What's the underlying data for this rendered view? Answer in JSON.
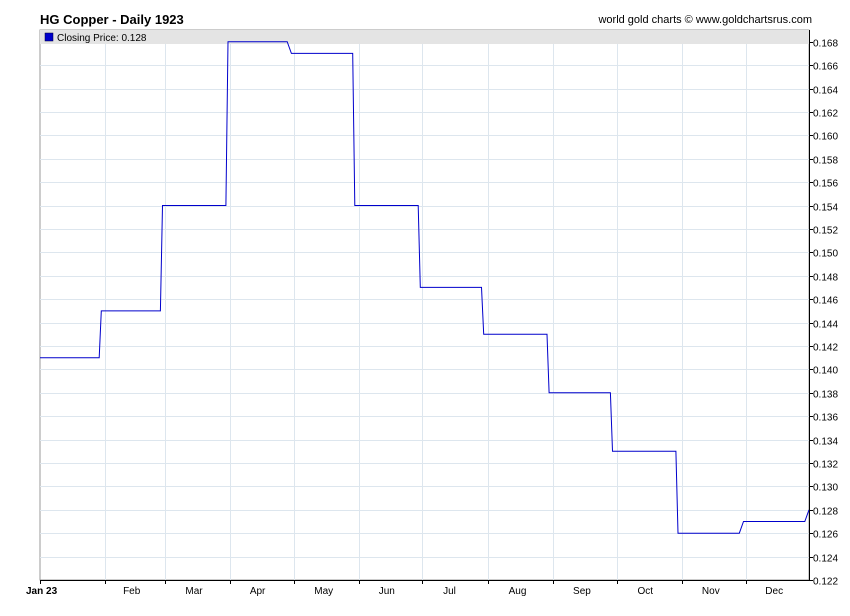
{
  "header": {
    "title": "HG Copper - Daily 1923",
    "credit": "world gold charts © www.goldchartsrus.com"
  },
  "colors": {
    "series": "#0000cc",
    "grid": "#dde6ee",
    "legend_bg": "#e4e4e4"
  },
  "chart_data": {
    "type": "line",
    "title": "HG Copper - Daily 1923",
    "xlabel": "",
    "ylabel": "",
    "grid": true,
    "legend": "top-left",
    "ylim": [
      0.122,
      0.169
    ],
    "y_ticks": [
      "0.122",
      "0.124",
      "0.126",
      "0.128",
      "0.130",
      "0.132",
      "0.134",
      "0.136",
      "0.138",
      "0.140",
      "0.142",
      "0.144",
      "0.146",
      "0.148",
      "0.150",
      "0.152",
      "0.154",
      "0.156",
      "0.158",
      "0.160",
      "0.162",
      "0.164",
      "0.166",
      "0.168"
    ],
    "x_ticks": [
      {
        "label": "Jan 23",
        "date": "1923-01-01"
      },
      {
        "label": "Feb",
        "date": "1923-02-01"
      },
      {
        "label": "Mar",
        "date": "1923-03-01"
      },
      {
        "label": "Apr",
        "date": "1923-04-01"
      },
      {
        "label": "May",
        "date": "1923-05-01"
      },
      {
        "label": "Jun",
        "date": "1923-06-01"
      },
      {
        "label": "Jul",
        "date": "1923-07-01"
      },
      {
        "label": "Aug",
        "date": "1923-08-01"
      },
      {
        "label": "Sep",
        "date": "1923-09-01"
      },
      {
        "label": "Oct",
        "date": "1923-10-01"
      },
      {
        "label": "Nov",
        "date": "1923-11-01"
      },
      {
        "label": "Dec",
        "date": "1923-12-01"
      }
    ],
    "xlim": [
      "1923-01-01",
      "1923-12-31"
    ],
    "series": [
      {
        "name": "Closing Price: 0.128",
        "points": [
          {
            "x": "1923-01-01",
            "y": 0.141
          },
          {
            "x": "1923-01-29",
            "y": 0.141
          },
          {
            "x": "1923-01-30",
            "y": 0.145
          },
          {
            "x": "1923-02-27",
            "y": 0.145
          },
          {
            "x": "1923-02-28",
            "y": 0.154
          },
          {
            "x": "1923-03-30",
            "y": 0.154
          },
          {
            "x": "1923-03-31",
            "y": 0.168
          },
          {
            "x": "1923-04-28",
            "y": 0.168
          },
          {
            "x": "1923-04-30",
            "y": 0.167
          },
          {
            "x": "1923-05-29",
            "y": 0.167
          },
          {
            "x": "1923-05-30",
            "y": 0.154
          },
          {
            "x": "1923-06-29",
            "y": 0.154
          },
          {
            "x": "1923-06-30",
            "y": 0.147
          },
          {
            "x": "1923-07-29",
            "y": 0.147
          },
          {
            "x": "1923-07-30",
            "y": 0.143
          },
          {
            "x": "1923-08-29",
            "y": 0.143
          },
          {
            "x": "1923-08-30",
            "y": 0.138
          },
          {
            "x": "1923-09-28",
            "y": 0.138
          },
          {
            "x": "1923-09-29",
            "y": 0.133
          },
          {
            "x": "1923-10-29",
            "y": 0.133
          },
          {
            "x": "1923-10-30",
            "y": 0.126
          },
          {
            "x": "1923-11-28",
            "y": 0.126
          },
          {
            "x": "1923-11-30",
            "y": 0.127
          },
          {
            "x": "1923-12-29",
            "y": 0.127
          },
          {
            "x": "1923-12-31",
            "y": 0.128
          }
        ]
      }
    ]
  }
}
